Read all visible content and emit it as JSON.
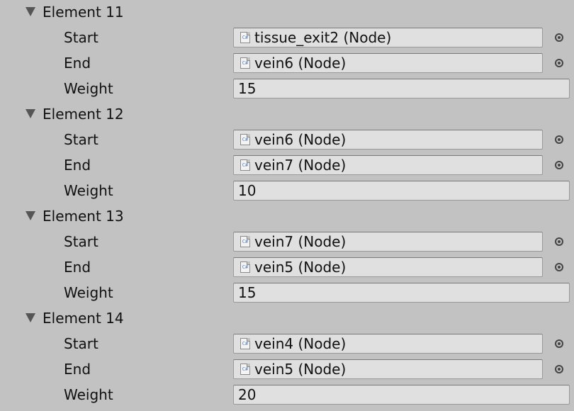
{
  "elements": [
    {
      "title": "Element 11",
      "start_label": "Start",
      "start_value": "tissue_exit2 (Node)",
      "end_label": "End",
      "end_value": "vein6 (Node)",
      "weight_label": "Weight",
      "weight_value": "15"
    },
    {
      "title": "Element 12",
      "start_label": "Start",
      "start_value": "vein6 (Node)",
      "end_label": "End",
      "end_value": "vein7 (Node)",
      "weight_label": "Weight",
      "weight_value": "10"
    },
    {
      "title": "Element 13",
      "start_label": "Start",
      "start_value": "vein7 (Node)",
      "end_label": "End",
      "end_value": "vein5 (Node)",
      "weight_label": "Weight",
      "weight_value": "15"
    },
    {
      "title": "Element 14",
      "start_label": "Start",
      "start_value": "vein4 (Node)",
      "end_label": "End",
      "end_value": "vein5 (Node)",
      "weight_label": "Weight",
      "weight_value": "20"
    }
  ],
  "icons": {
    "script_icon": "csharp-script-icon",
    "picker_icon": "object-picker-icon",
    "foldout_icon": "foldout-triangle-icon"
  },
  "script_icon_text": "C#",
  "colors": {
    "background": "#c2c2c2",
    "field": "#e0e0e0",
    "script_icon_accent": "#5a7fb8"
  }
}
